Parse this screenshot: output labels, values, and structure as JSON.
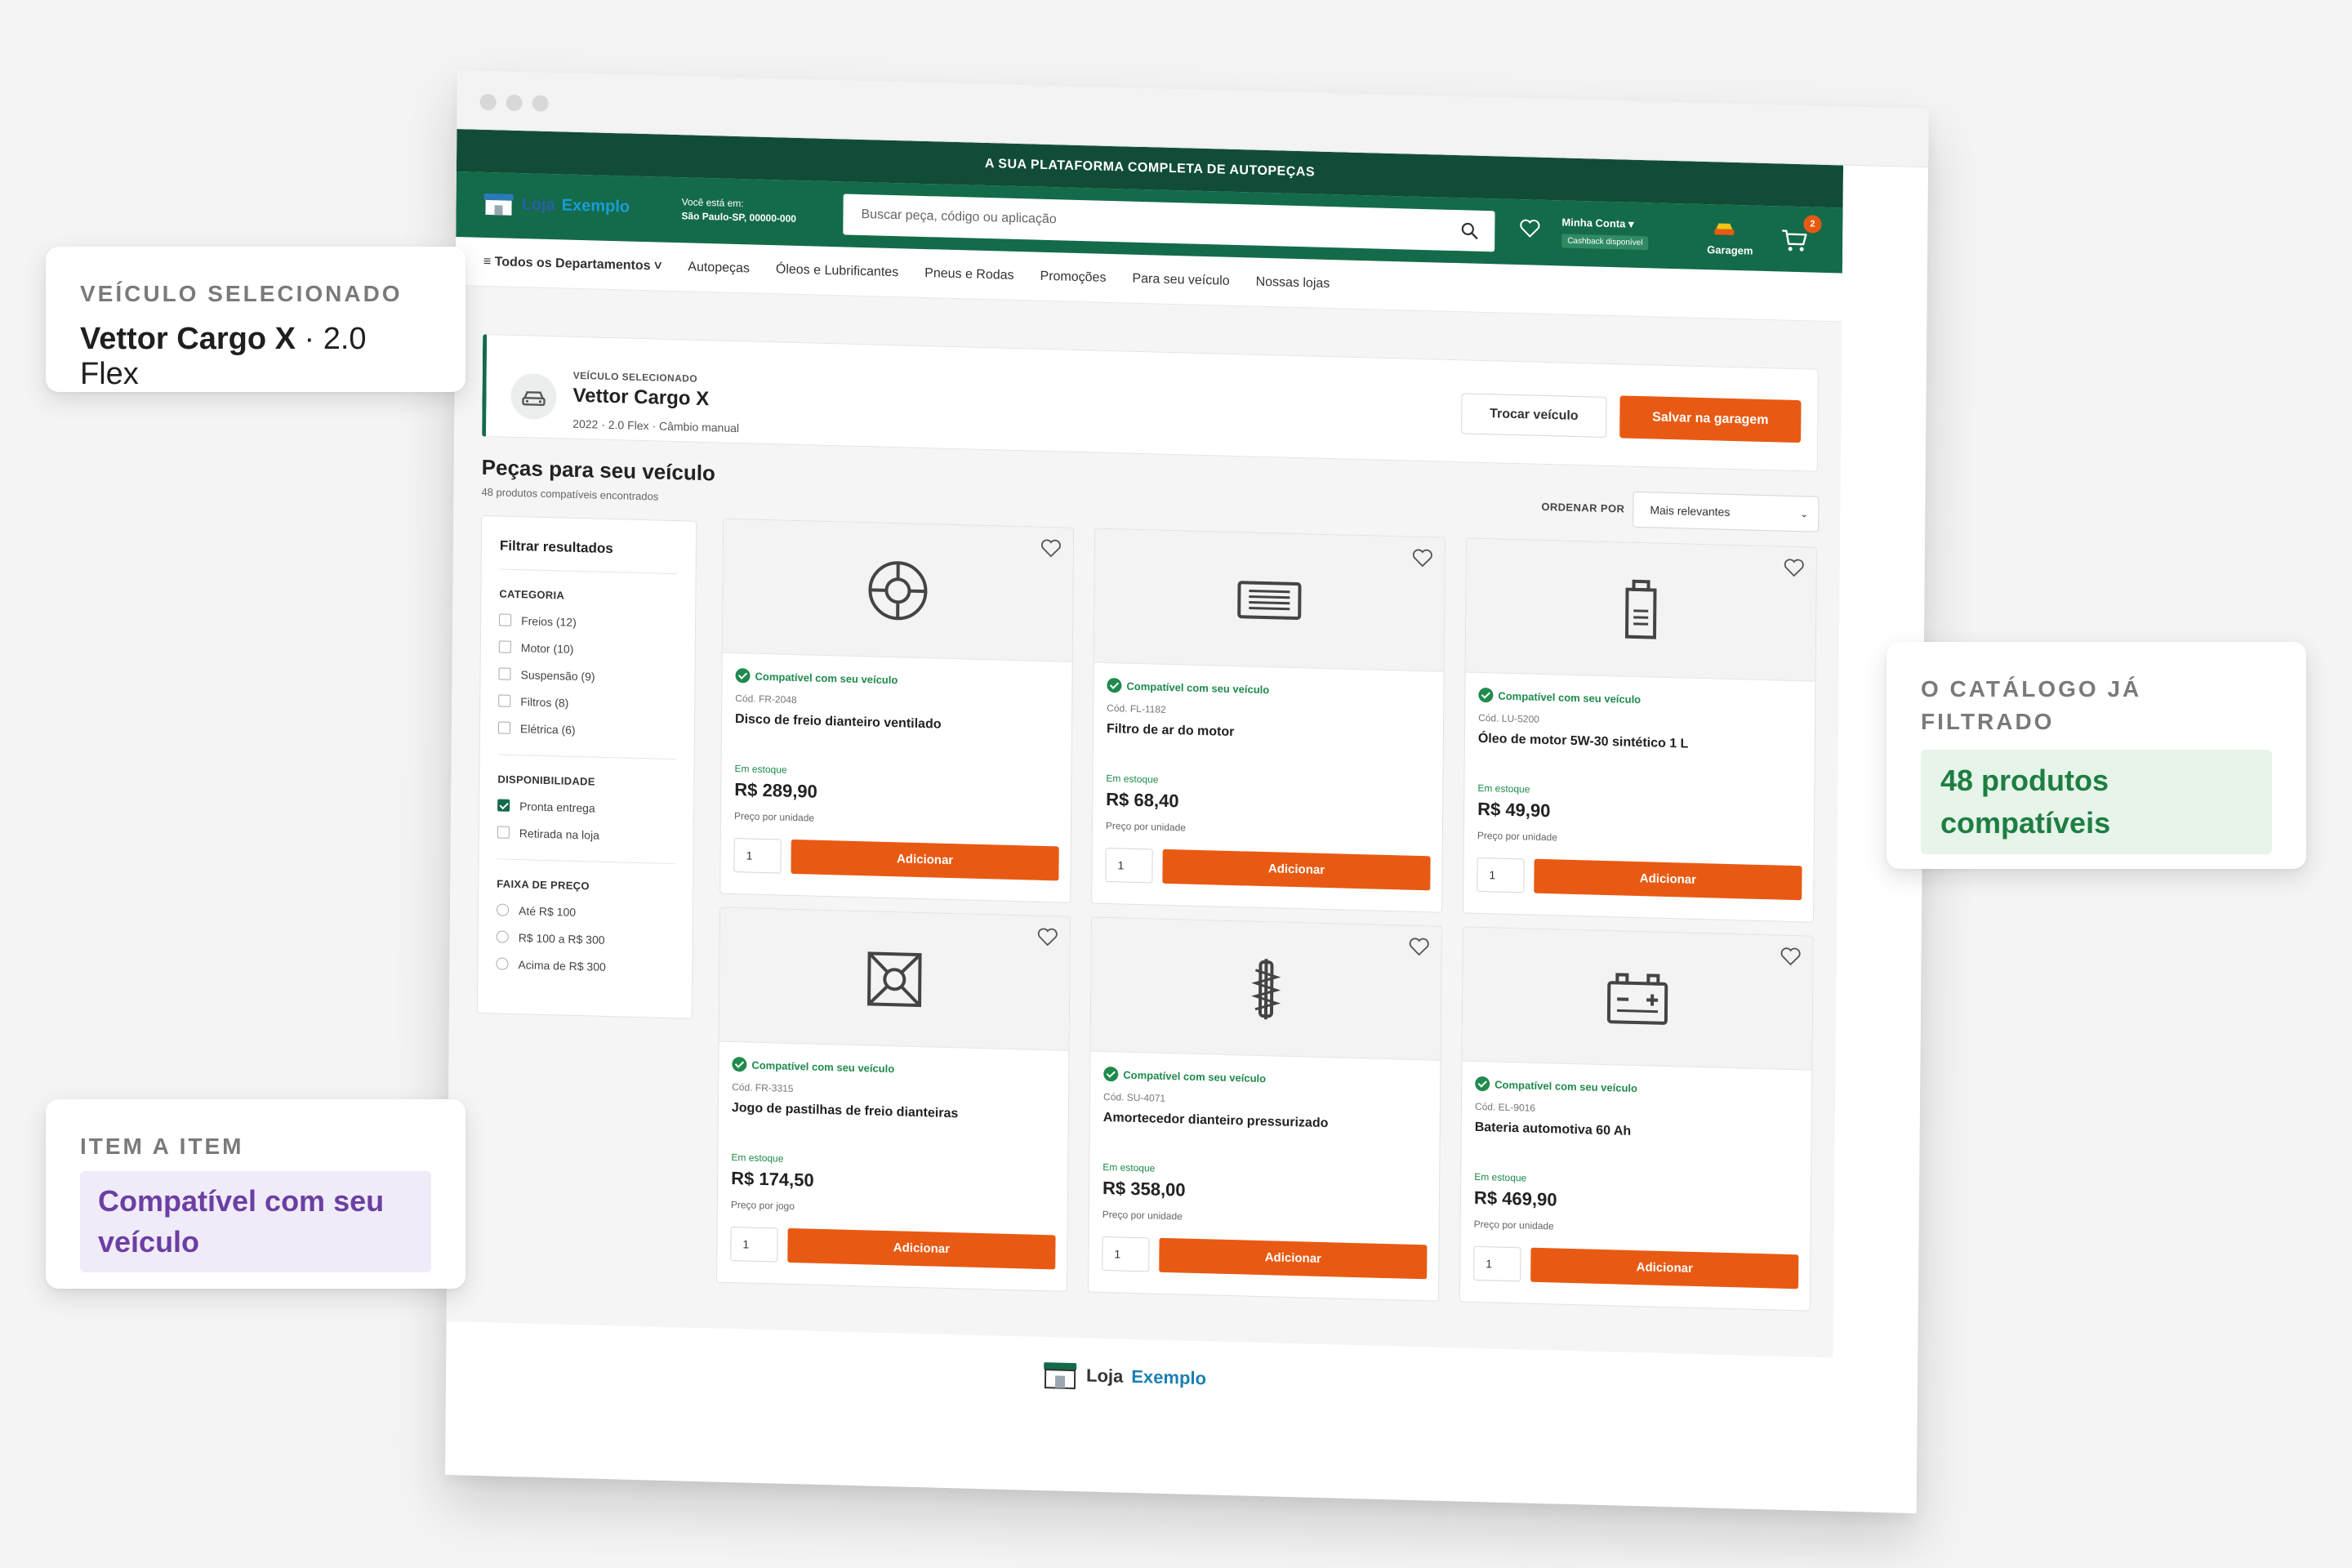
{
  "promo_bar": "A SUA PLATAFORMA COMPLETA DE AUTOPEÇAS",
  "header": {
    "logo": {
      "word1": "Loja",
      "word2": "Exemplo"
    },
    "location": {
      "label": "Você está em:",
      "value": "São Paulo-SP, 00000-000"
    },
    "search_placeholder": "Buscar peça, código ou aplicação",
    "account": {
      "label": "Minha Conta",
      "cashback": "Cashback disponível"
    },
    "garage": "Garagem",
    "cart_count": "2"
  },
  "nav": {
    "departments": "≡ Todos os Departamentos ˅",
    "items": [
      "Autopeças",
      "Óleos e Lubrificantes",
      "Pneus e Rodas",
      "Promoções",
      "Para seu veículo",
      "Nossas lojas"
    ]
  },
  "vehicle": {
    "label": "VEÍCULO SELECIONADO",
    "name": "Vettor Cargo X",
    "details": "2022 · 2.0 Flex · Câmbio manual",
    "change_button": "Trocar veículo",
    "save_button": "Salvar na garagem"
  },
  "products_section": {
    "title": "Peças para seu veículo",
    "count": "48 produtos compatíveis encontrados",
    "sort_label": "ORDENAR POR",
    "sort_value": "Mais relevantes"
  },
  "filters": {
    "title": "Filtrar resultados",
    "category": {
      "title": "CATEGORIA",
      "items": [
        {
          "label": "Freios  (12)",
          "checked": false
        },
        {
          "label": "Motor  (10)",
          "checked": false
        },
        {
          "label": "Suspensão  (9)",
          "checked": false
        },
        {
          "label": "Filtros  (8)",
          "checked": false
        },
        {
          "label": "Elétrica  (6)",
          "checked": false
        }
      ]
    },
    "availability": {
      "title": "DISPONIBILIDADE",
      "items": [
        {
          "label": "Pronta entrega",
          "checked": true
        },
        {
          "label": "Retirada na loja",
          "checked": false
        }
      ]
    },
    "price": {
      "title": "FAIXA DE PREÇO",
      "items": [
        "Até R$ 100",
        "R$ 100 a R$ 300",
        "Acima de R$ 300"
      ]
    }
  },
  "products": [
    {
      "icon": "brake-disc-icon",
      "compat": "Compatível com seu veículo",
      "code": "Cód. FR-2048",
      "name": "Disco de freio dianteiro ventilado",
      "stock": "Em estoque",
      "price": "R$ 289,90",
      "unit": "Preço por unidade",
      "qty": "1",
      "add": "Adicionar"
    },
    {
      "icon": "air-filter-icon",
      "compat": "Compatível com seu veículo",
      "code": "Cód. FL-1182",
      "name": "Filtro de ar do motor",
      "stock": "Em estoque",
      "price": "R$ 68,40",
      "unit": "Preço por unidade",
      "qty": "1",
      "add": "Adicionar"
    },
    {
      "icon": "oil-bottle-icon",
      "compat": "Compatível com seu veículo",
      "code": "Cód. LU-5200",
      "name": "Óleo de motor 5W-30 sintético 1 L",
      "stock": "Em estoque",
      "price": "R$ 49,90",
      "unit": "Preço por unidade",
      "qty": "1",
      "add": "Adicionar"
    },
    {
      "icon": "brake-pads-icon",
      "compat": "Compatível com seu veículo",
      "code": "Cód. FR-3315",
      "name": "Jogo de pastilhas de freio dianteiras",
      "stock": "Em estoque",
      "price": "R$ 174,50",
      "unit": "Preço por jogo",
      "qty": "1",
      "add": "Adicionar"
    },
    {
      "icon": "shock-absorber-icon",
      "compat": "Compatível com seu veículo",
      "code": "Cód. SU-4071",
      "name": "Amortecedor dianteiro pressurizado",
      "stock": "Em estoque",
      "price": "R$ 358,00",
      "unit": "Preço por unidade",
      "qty": "1",
      "add": "Adicionar"
    },
    {
      "icon": "battery-icon",
      "compat": "Compatível com seu veículo",
      "code": "Cód. EL-9016",
      "name": "Bateria automotiva 60 Ah",
      "stock": "Em estoque",
      "price": "R$ 469,90",
      "unit": "Preço por unidade",
      "qty": "1",
      "add": "Adicionar"
    }
  ],
  "footer_logo": {
    "word1": "Loja",
    "word2": "Exemplo"
  },
  "callouts": {
    "vehicle": {
      "label": "VEÍCULO SELECIONADO",
      "name": "Vettor Cargo X",
      "suffix": " · 2.0 Flex"
    },
    "item": {
      "label": "ITEM A ITEM",
      "value": "Compatível com seu veículo"
    },
    "catalog": {
      "label": "O CATÁLOGO JÁ FILTRADO",
      "value": "48 produtos compatíveis"
    }
  },
  "colors": {
    "header_green": "#136b4a",
    "promo_green": "#114c38",
    "accent_orange": "#e85a13",
    "compat_green": "#1f8a4c",
    "purple_accent": "#6b3fa3"
  }
}
